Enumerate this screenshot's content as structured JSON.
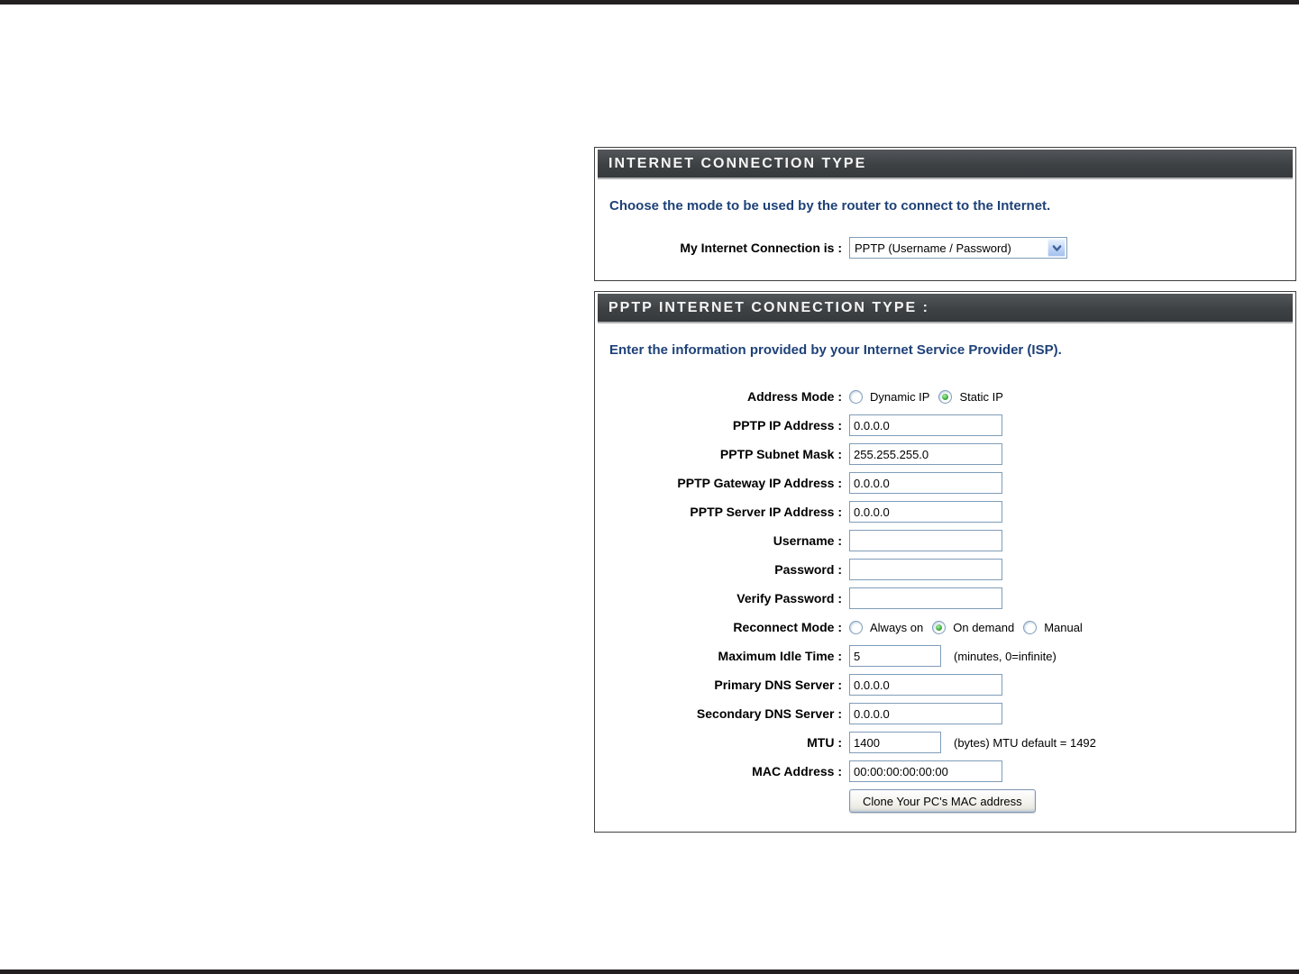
{
  "page": {
    "background_color": "#ffffff",
    "top_rule_color": "#231f20",
    "bottom_rule_color": "#231f20"
  },
  "theme": {
    "section_header_bg": "#3d4144",
    "section_header_text": "#ffffff",
    "instruction_text_color": "#1e4178",
    "box_border_color": "#404040",
    "input_border_color": "#7f9db9",
    "radio_selected_color": "#2f9e2f",
    "select_arrow_color": "#41629b"
  },
  "internet_connection_section": {
    "header": "INTERNET CONNECTION TYPE",
    "instruction": "Choose the mode to be used by the router to connect to the Internet.",
    "my_connection": {
      "label": "My Internet Connection is :",
      "selected_option": "PPTP (Username / Password)"
    }
  },
  "pptp_section": {
    "header": "PPTP INTERNET CONNECTION TYPE :",
    "instruction": "Enter the information provided by your Internet Service Provider (ISP).",
    "address_mode": {
      "label": "Address Mode :",
      "options": [
        {
          "label": "Dynamic IP",
          "selected": false
        },
        {
          "label": "Static IP",
          "selected": true
        }
      ]
    },
    "rows": {
      "pptp_ip": {
        "label": "PPTP IP Address :",
        "value": "0.0.0.0"
      },
      "pptp_subnet": {
        "label": "PPTP Subnet Mask :",
        "value": "255.255.255.0"
      },
      "pptp_gateway": {
        "label": "PPTP Gateway IP Address :",
        "value": "0.0.0.0"
      },
      "pptp_server": {
        "label": "PPTP Server IP Address :",
        "value": "0.0.0.0"
      },
      "username": {
        "label": "Username :",
        "value": ""
      },
      "password": {
        "label": "Password :",
        "value": ""
      },
      "verify_password": {
        "label": "Verify Password :",
        "value": ""
      },
      "max_idle": {
        "label": "Maximum Idle Time :",
        "value": "5",
        "note": "(minutes, 0=infinite)"
      },
      "primary_dns": {
        "label": "Primary DNS Server :",
        "value": "0.0.0.0"
      },
      "secondary_dns": {
        "label": "Secondary DNS Server :",
        "value": "0.0.0.0"
      },
      "mtu": {
        "label": "MTU :",
        "value": "1400",
        "note": "(bytes) MTU default = 1492"
      },
      "mac": {
        "label": "MAC Address :",
        "value": "00:00:00:00:00:00"
      }
    },
    "reconnect_mode": {
      "label": "Reconnect Mode :",
      "options": [
        {
          "label": "Always on",
          "selected": false
        },
        {
          "label": "On demand",
          "selected": true
        },
        {
          "label": "Manual",
          "selected": false
        }
      ]
    },
    "clone_mac_button": "Clone Your PC's MAC address"
  }
}
